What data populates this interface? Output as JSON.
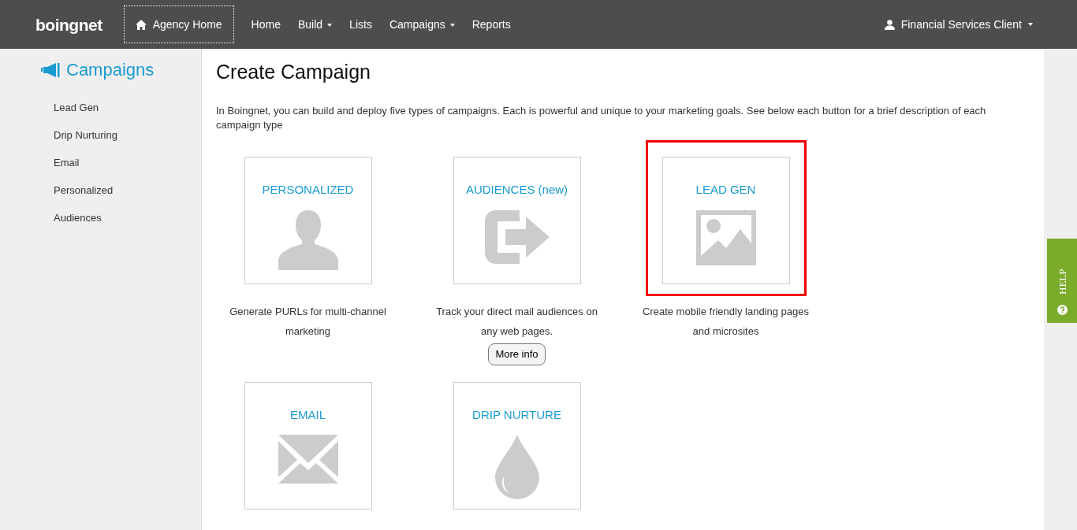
{
  "navbar": {
    "logo": "boingnet",
    "agency_home": "Agency Home",
    "items": [
      {
        "label": "Home",
        "dropdown": false
      },
      {
        "label": "Build",
        "dropdown": true
      },
      {
        "label": "Lists",
        "dropdown": false
      },
      {
        "label": "Campaigns",
        "dropdown": true
      },
      {
        "label": "Reports",
        "dropdown": false
      }
    ],
    "user": {
      "label": "Financial Services Client",
      "dropdown": true
    }
  },
  "sidebar": {
    "title": "Campaigns",
    "items": [
      "Lead Gen",
      "Drip Nurturing",
      "Email",
      "Personalized",
      "Audiences"
    ]
  },
  "main": {
    "title": "Create Campaign",
    "intro": "In Boingnet, you can build and deploy five types of campaigns. Each is powerful and unique to your marketing goals. See below each button for a brief description of each campaign type",
    "campaigns": [
      {
        "title": "PERSONALIZED",
        "kind": "person",
        "description": "Generate PURLs for multi-channel marketing",
        "highlighted": false
      },
      {
        "title": "AUDIENCES (new)",
        "kind": "exit",
        "description": "Track your direct mail audiences on any web pages.",
        "button": "More info",
        "highlighted": false
      },
      {
        "title": "LEAD GEN",
        "kind": "image",
        "description": "Create mobile friendly landing pages and microsites",
        "highlighted": true
      },
      {
        "title": "EMAIL",
        "kind": "envelope",
        "highlighted": false
      },
      {
        "title": "DRIP NURTURE",
        "kind": "drop",
        "highlighted": false
      }
    ]
  },
  "help_tab": {
    "label": "HELP"
  }
}
